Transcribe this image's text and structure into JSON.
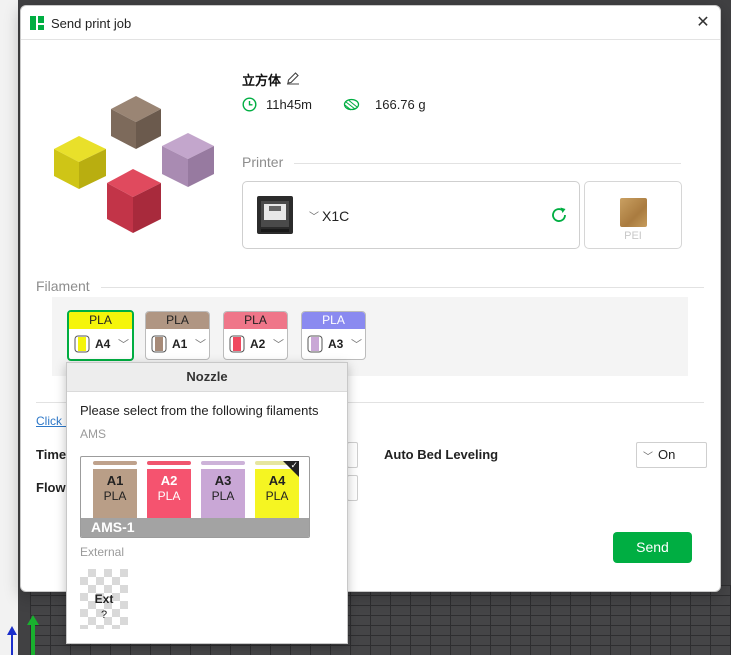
{
  "window": {
    "title": "Send print job",
    "close_glyph": "✕"
  },
  "model": {
    "name": "立方体",
    "time": "11h45m",
    "weight": "166.76 g"
  },
  "printer": {
    "section_label": "Printer",
    "name": "X1C",
    "plate_label": "PEI"
  },
  "filament": {
    "section_label": "Filament",
    "slots": [
      {
        "type": "PLA",
        "id": "A4",
        "color": "#f5f50a",
        "active": true
      },
      {
        "type": "PLA",
        "id": "A1",
        "color": "#a68a78",
        "active": false
      },
      {
        "type": "PLA",
        "id": "A2",
        "color": "#ef7689",
        "active": false
      },
      {
        "type": "PLA",
        "id": "A3",
        "color": "#8a8af0",
        "active": false
      }
    ]
  },
  "options": {
    "link_text": "Click h",
    "timelapse_label": "Timel",
    "flow_label": "Flow",
    "auto_bed_label": "Auto Bed Leveling",
    "auto_bed_value": "On"
  },
  "send_label": "Send",
  "popup": {
    "title": "Nozzle",
    "hint": "Please select from the following filaments",
    "ams_label": "AMS",
    "ams_name": "AMS-1",
    "external_label": "External",
    "slots": [
      {
        "id": "A1",
        "type": "PLA",
        "color": "#b99e87",
        "bar": "#bfa28c",
        "selected": false
      },
      {
        "id": "A2",
        "type": "PLA",
        "color": "#f5536f",
        "bar": "#f0566f",
        "selected": false
      },
      {
        "id": "A3",
        "type": "PLA",
        "color": "#c9a7d6",
        "bar": "#cdb3d9",
        "selected": false
      },
      {
        "id": "A4",
        "type": "PLA",
        "color": "#f5f522",
        "bar": "#e6e6a0",
        "selected": true
      }
    ],
    "external": {
      "id": "Ext",
      "type": "?"
    }
  },
  "colors": {
    "accent": "#00ae42"
  }
}
